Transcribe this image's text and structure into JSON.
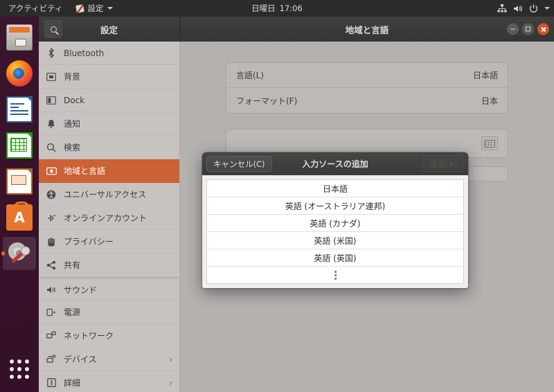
{
  "topbar": {
    "activities": "アクティビティ",
    "app_menu": "設定",
    "app_icon": "settings-icon",
    "clock_day": "日曜日",
    "clock_time": "17:06",
    "indicators": [
      "network-icon",
      "volume-icon",
      "power-icon",
      "chevron-down-icon"
    ]
  },
  "dock": {
    "items": [
      {
        "name": "files",
        "icon": "files-icon",
        "active": false
      },
      {
        "name": "firefox",
        "icon": "firefox-icon",
        "active": false
      },
      {
        "name": "writer",
        "icon": "libreoffice-writer-icon",
        "active": false
      },
      {
        "name": "calc",
        "icon": "libreoffice-calc-icon",
        "active": false
      },
      {
        "name": "impress",
        "icon": "libreoffice-impress-icon",
        "active": false
      },
      {
        "name": "software",
        "icon": "ubuntu-software-icon",
        "active": false
      },
      {
        "name": "settings",
        "icon": "settings-icon",
        "active": true
      }
    ],
    "show_applications": "show-applications-grid-icon"
  },
  "window": {
    "left_header": {
      "search_icon": "search-icon",
      "title": "設定"
    },
    "right_header": {
      "title": "地域と言語",
      "controls": [
        "minimize",
        "maximize",
        "close"
      ]
    }
  },
  "sidebar": {
    "items": [
      {
        "label": "Bluetooth",
        "icon": "bluetooth-icon",
        "selected": false,
        "chevron": false,
        "group_start": false
      },
      {
        "label": "背景",
        "icon": "wallpaper-icon",
        "selected": false,
        "chevron": false,
        "group_start": false
      },
      {
        "label": "Dock",
        "icon": "dock-icon",
        "selected": false,
        "chevron": false,
        "group_start": false
      },
      {
        "label": "通知",
        "icon": "bell-icon",
        "selected": false,
        "chevron": false,
        "group_start": false
      },
      {
        "label": "検索",
        "icon": "search-icon",
        "selected": false,
        "chevron": false,
        "group_start": false
      },
      {
        "label": "地域と言語",
        "icon": "region-language-icon",
        "selected": true,
        "chevron": false,
        "group_start": false
      },
      {
        "label": "ユニバーサルアクセス",
        "icon": "universal-access-icon",
        "selected": false,
        "chevron": false,
        "group_start": false
      },
      {
        "label": "オンラインアカウント",
        "icon": "online-accounts-icon",
        "selected": false,
        "chevron": false,
        "group_start": false
      },
      {
        "label": "プライバシー",
        "icon": "privacy-hand-icon",
        "selected": false,
        "chevron": false,
        "group_start": false
      },
      {
        "label": "共有",
        "icon": "sharing-icon",
        "selected": false,
        "chevron": false,
        "group_start": false
      },
      {
        "label": "サウンド",
        "icon": "sound-icon",
        "selected": false,
        "chevron": false,
        "group_start": true
      },
      {
        "label": "電源",
        "icon": "power-icon",
        "selected": false,
        "chevron": false,
        "group_start": false
      },
      {
        "label": "ネットワーク",
        "icon": "network-icon",
        "selected": false,
        "chevron": false,
        "group_start": false
      },
      {
        "label": "デバイス",
        "icon": "devices-icon",
        "selected": false,
        "chevron": true,
        "group_start": false
      },
      {
        "label": "詳細",
        "icon": "details-icon",
        "selected": false,
        "chevron": true,
        "group_start": false
      }
    ]
  },
  "main": {
    "rows": [
      {
        "label": "言語(L)",
        "value": "日本語"
      },
      {
        "label": "フォーマット(F)",
        "value": "日本"
      }
    ],
    "keyboard_button_icon": "keyboard-icon"
  },
  "dialog": {
    "cancel_label": "キャンセル(C)",
    "title": "入力ソースの追加",
    "add_label": "追加(A)",
    "add_disabled": true,
    "list": [
      "日本語",
      "英語 (オーストラリア連邦)",
      "英語 (カナダ)",
      "英語 (米国)",
      "英語 (英国)"
    ],
    "more_row_icon": "more-vertical-icon"
  },
  "colors": {
    "accent_orange": "#cd6136",
    "panel_dark": "#2b2b29",
    "headerbar": "#3b3b39",
    "sidebar_bg": "#c6c3c0",
    "main_bg": "#b4b1ae",
    "close_button": "#d2552a"
  }
}
